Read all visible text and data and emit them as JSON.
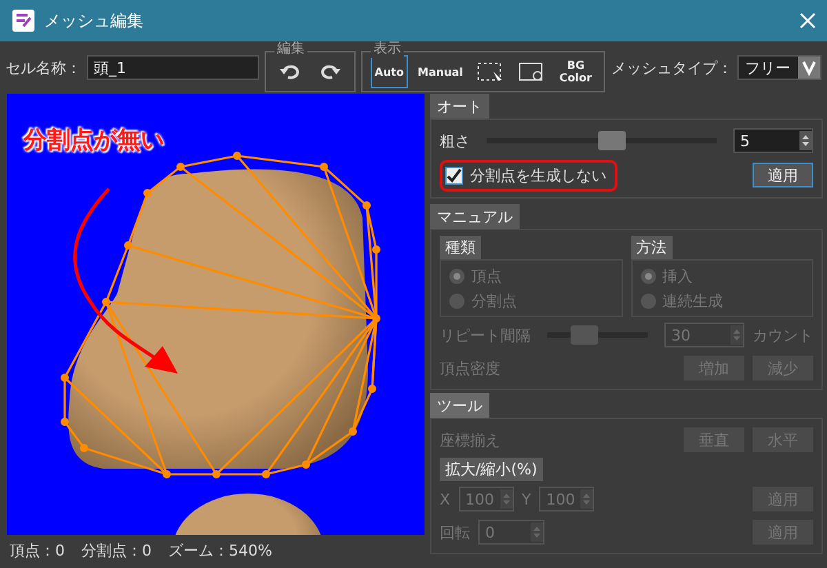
{
  "window": {
    "title": "メッシュ編集"
  },
  "toolbar": {
    "cell_name": {
      "label": "セル名称：",
      "value": "頭_1"
    },
    "edit_group": {
      "title": "編集"
    },
    "display_group": {
      "title": "表示",
      "buttons": [
        {
          "kind": "auto",
          "label": "Auto",
          "selected": true
        },
        {
          "kind": "manual",
          "label": "Manual",
          "selected": false
        },
        {
          "kind": "select",
          "selected": false
        },
        {
          "kind": "zoom",
          "selected": false
        },
        {
          "kind": "bg",
          "lines": [
            "BG",
            "Color"
          ],
          "selected": false
        }
      ]
    },
    "mesh_type": {
      "label": "メッシュタイプ：",
      "value": "フリー"
    }
  },
  "canvas": {
    "annotation": "分割点が無い"
  },
  "status_bar": [
    "頂点：0",
    "分割点：0",
    "ズーム：540%"
  ],
  "auto": {
    "title": "オート",
    "coarseness": {
      "label": "粗さ",
      "level": 0.55,
      "value": "5"
    },
    "no_split": {
      "label": "分割点を生成しない",
      "checked": true,
      "highlighted": true
    },
    "apply": "適用"
  },
  "manual": {
    "title": "マニュアル",
    "disabled": true,
    "groups": [
      {
        "title": "種類",
        "options": [
          {
            "label": "頂点",
            "selected": true
          },
          {
            "label": "分割点",
            "selected": false
          }
        ]
      },
      {
        "title": "方法",
        "options": [
          {
            "label": "挿入",
            "selected": true
          },
          {
            "label": "連続生成",
            "selected": false
          }
        ]
      }
    ],
    "repeat": {
      "label": "リピート間隔",
      "level": 0.32,
      "value": "30",
      "unit": "カウント"
    },
    "density": {
      "label": "頂点密度",
      "buttons": [
        "増加",
        "減少"
      ]
    }
  },
  "tools": {
    "title": "ツール",
    "disabled": true,
    "align": {
      "label": "座標揃え",
      "buttons": [
        "垂直",
        "水平"
      ]
    },
    "scale": {
      "title": "拡大/縮小(%)",
      "x_label": "X",
      "x_value": "100",
      "y_label": "Y",
      "y_value": "100",
      "apply": "適用"
    },
    "rotate": {
      "label": "回転",
      "value": "0",
      "apply": "適用"
    }
  }
}
